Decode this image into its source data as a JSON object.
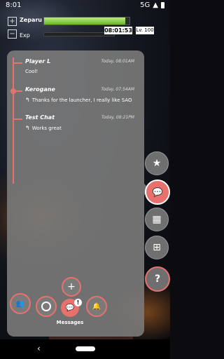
{
  "status": {
    "time": "8:01",
    "network": "5G"
  },
  "hud": {
    "name": "Zeparu",
    "exp_label": "Exp",
    "plus": "+",
    "minus": "−",
    "clock": "08:01:53",
    "level": "Lv. 100",
    "hp_fraction": 0.95
  },
  "messages": [
    {
      "sender": "Player L",
      "timestamp": "Today, 08:01AM",
      "text": "Cool!",
      "is_reply": false
    },
    {
      "sender": "Kerogane",
      "timestamp": "Today, 07:54AM",
      "text": "Thanks for the launcher, I really like SAO",
      "is_reply": true
    },
    {
      "sender": "Test Chat",
      "timestamp": "Today, 08:21PM",
      "text": "Works great",
      "is_reply": true
    }
  ],
  "bottom": {
    "active_label": "Messages",
    "badge": "!"
  },
  "colors": {
    "accent": "#e8716d",
    "panel": "#787878"
  }
}
